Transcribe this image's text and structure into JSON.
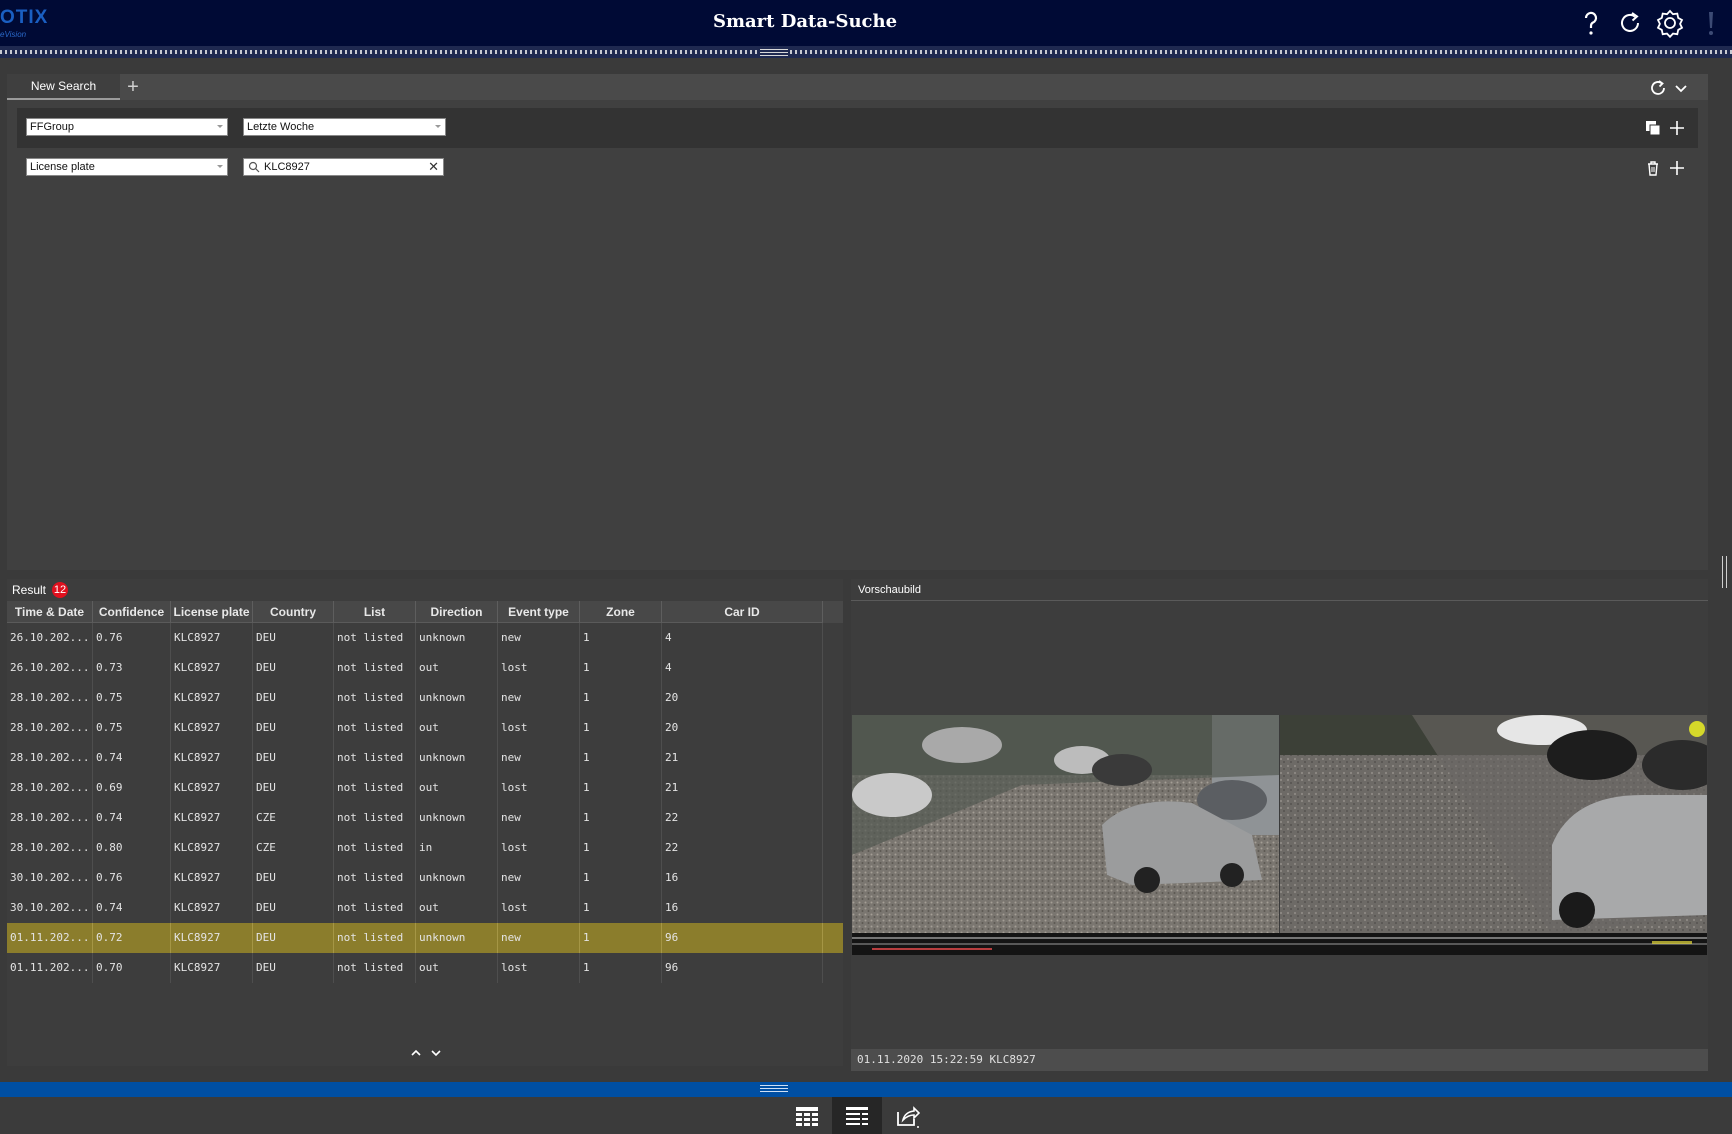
{
  "header": {
    "logo_text": "OTIX",
    "logo_sub": "eVision",
    "title": "Smart Data-Suche",
    "icons": [
      "help-icon",
      "refresh-icon",
      "settings-icon",
      "alert-icon"
    ]
  },
  "search": {
    "tabs": [
      {
        "label": "New Search",
        "active": true
      }
    ],
    "add_tab_icon": "plus-icon",
    "row1": {
      "source_select": "FFGroup",
      "time_select": "Letzte Woche"
    },
    "row2": {
      "field_select": "License plate",
      "query_value": "KLC8927"
    }
  },
  "result": {
    "label": "Result",
    "count": "12",
    "columns": [
      "Time & Date",
      "Confidence",
      "License plate",
      "Country",
      "List",
      "Direction",
      "Event type",
      "Zone",
      "Car ID"
    ],
    "rows": [
      [
        "26.10.202...",
        "0.76",
        "KLC8927",
        "DEU",
        "not listed",
        "unknown",
        "new",
        "1",
        "4"
      ],
      [
        "26.10.202...",
        "0.73",
        "KLC8927",
        "DEU",
        "not listed",
        "out",
        "lost",
        "1",
        "4"
      ],
      [
        "28.10.202...",
        "0.75",
        "KLC8927",
        "DEU",
        "not listed",
        "unknown",
        "new",
        "1",
        "20"
      ],
      [
        "28.10.202...",
        "0.75",
        "KLC8927",
        "DEU",
        "not listed",
        "out",
        "lost",
        "1",
        "20"
      ],
      [
        "28.10.202...",
        "0.74",
        "KLC8927",
        "DEU",
        "not listed",
        "unknown",
        "new",
        "1",
        "21"
      ],
      [
        "28.10.202...",
        "0.69",
        "KLC8927",
        "DEU",
        "not listed",
        "out",
        "lost",
        "1",
        "21"
      ],
      [
        "28.10.202...",
        "0.74",
        "KLC8927",
        "CZE",
        "not listed",
        "unknown",
        "new",
        "1",
        "22"
      ],
      [
        "28.10.202...",
        "0.80",
        "KLC8927",
        "CZE",
        "not listed",
        "in",
        "lost",
        "1",
        "22"
      ],
      [
        "30.10.202...",
        "0.76",
        "KLC8927",
        "DEU",
        "not listed",
        "unknown",
        "new",
        "1",
        "16"
      ],
      [
        "30.10.202...",
        "0.74",
        "KLC8927",
        "DEU",
        "not listed",
        "out",
        "lost",
        "1",
        "16"
      ],
      [
        "01.11.202...",
        "0.72",
        "KLC8927",
        "DEU",
        "not listed",
        "unknown",
        "new",
        "1",
        "96"
      ],
      [
        "01.11.202...",
        "0.70",
        "KLC8927",
        "DEU",
        "not listed",
        "out",
        "lost",
        "1",
        "96"
      ]
    ],
    "selected_row": 10
  },
  "preview": {
    "label": "Vorschaubild",
    "caption": "01.11.2020 15:22:59 KLC8927"
  },
  "toolbar": {
    "buttons": [
      "grid-view-icon",
      "list-detail-view-icon",
      "export-icon"
    ],
    "active": 1
  },
  "colors": {
    "header_bg": "#000a35",
    "selected_row": "#8b7d2c",
    "badge": "#e0101e",
    "bottom_bar": "#004fa3"
  }
}
